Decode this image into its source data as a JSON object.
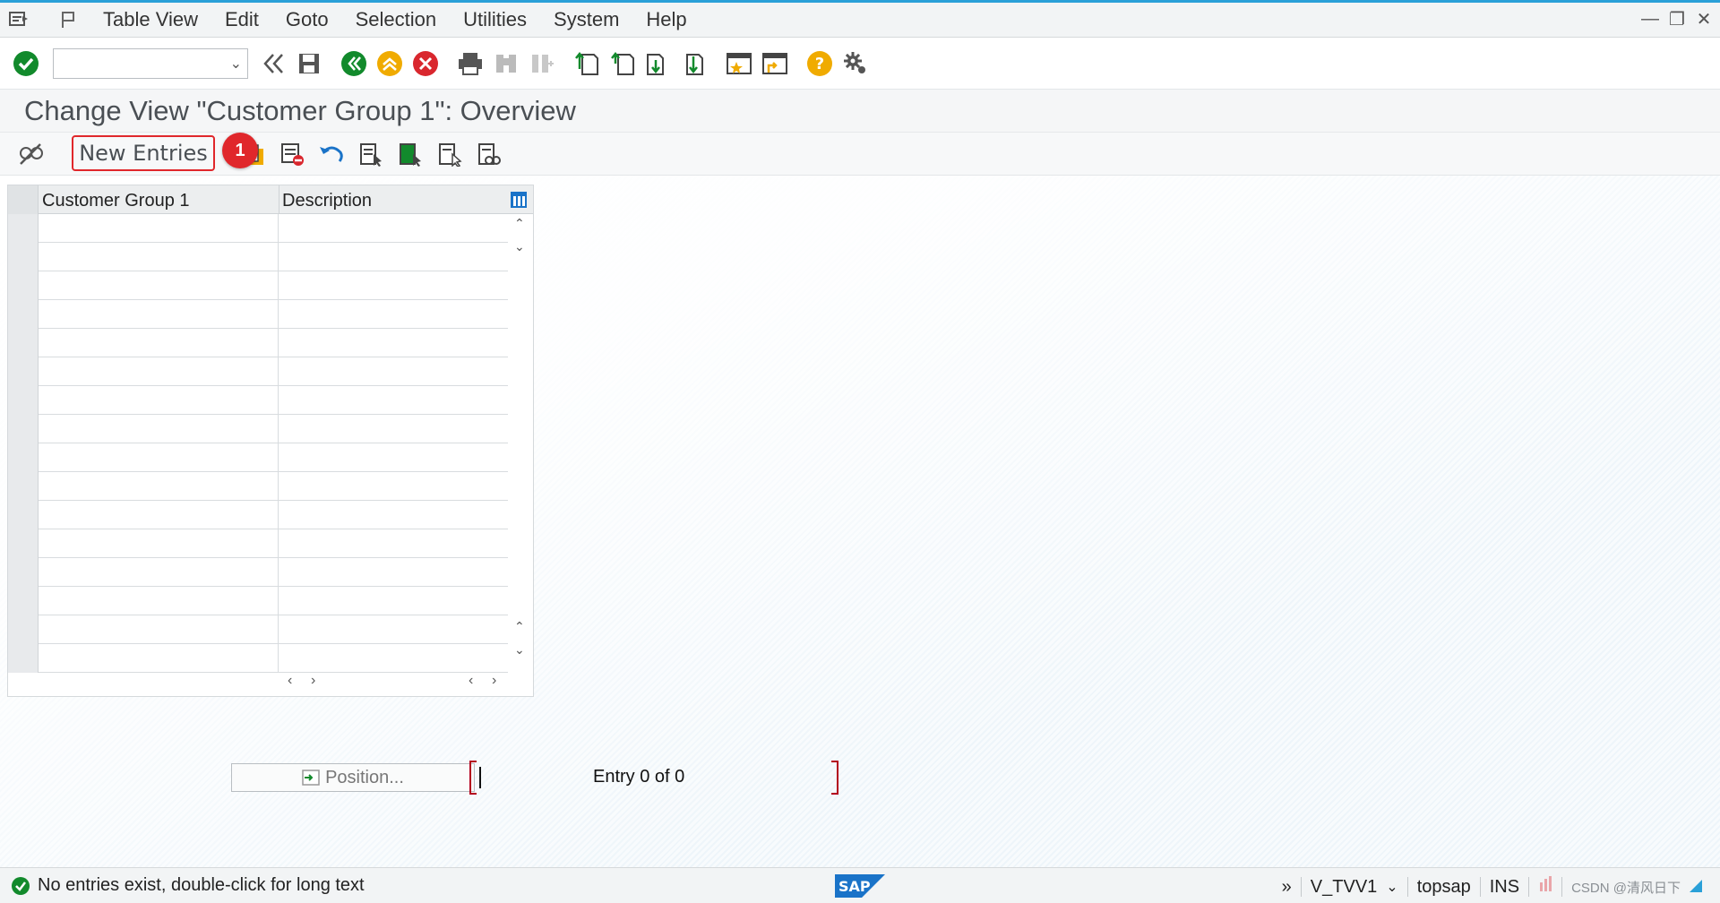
{
  "menu": {
    "items": [
      "Table View",
      "Edit",
      "Goto",
      "Selection",
      "Utilities",
      "System",
      "Help"
    ]
  },
  "toolbar": {
    "command_value": ""
  },
  "page": {
    "title": "Change View \"Customer Group 1\": Overview"
  },
  "app_toolbar": {
    "new_entries_label": "New Entries",
    "badge": "1"
  },
  "table": {
    "columns": [
      "Customer Group 1",
      "Description"
    ],
    "rows": [
      [
        "",
        ""
      ],
      [
        "",
        ""
      ],
      [
        "",
        ""
      ],
      [
        "",
        ""
      ],
      [
        "",
        ""
      ],
      [
        "",
        ""
      ],
      [
        "",
        ""
      ],
      [
        "",
        ""
      ],
      [
        "",
        ""
      ],
      [
        "",
        ""
      ],
      [
        "",
        ""
      ],
      [
        "",
        ""
      ],
      [
        "",
        ""
      ],
      [
        "",
        ""
      ],
      [
        "",
        ""
      ],
      [
        "",
        ""
      ]
    ]
  },
  "position": {
    "label": "Position...",
    "entry_text": "Entry 0 of 0"
  },
  "status": {
    "message": "No entries exist, double-click for long text",
    "transaction": "V_TVV1",
    "server": "topsap",
    "mode": "INS",
    "watermark": "CSDN @清风日下"
  },
  "colors": {
    "accent": "#2aa0d8",
    "highlight_red": "#e0272b",
    "ok_green": "#128a2c"
  }
}
